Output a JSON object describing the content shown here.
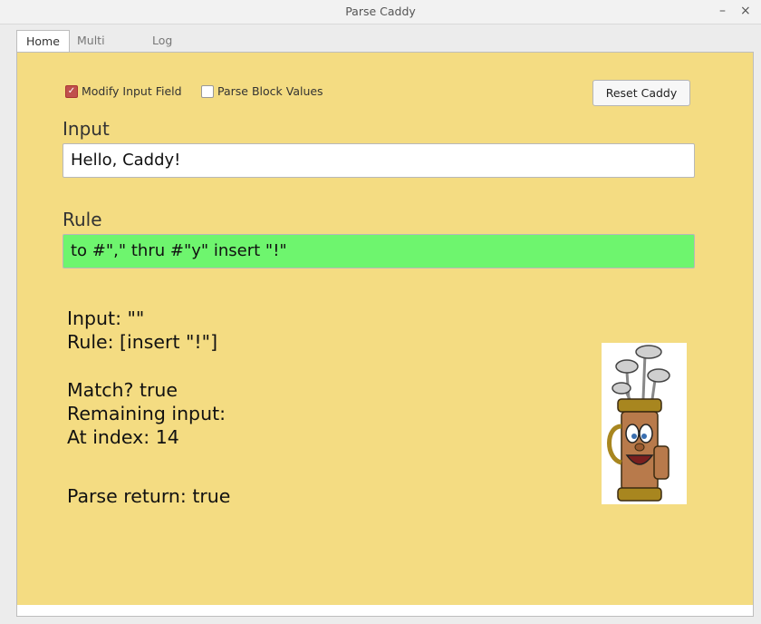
{
  "window": {
    "title": "Parse Caddy",
    "minimize": "–",
    "close": "×"
  },
  "tabs": [
    "Home",
    "Multi Rule",
    "Log"
  ],
  "options": {
    "modify_input": {
      "label": "Modify Input Field",
      "checked": true
    },
    "parse_block": {
      "label": "Parse Block Values",
      "checked": false
    }
  },
  "reset_button": "Reset Caddy",
  "input": {
    "label": "Input",
    "value": "Hello, Caddy!"
  },
  "rule": {
    "label": "Rule",
    "value": "to #\",\" thru #\"y\" insert \"!\""
  },
  "output": {
    "input_line": "Input: \"\"",
    "rule_line": "Rule: [insert \"!\"]",
    "match_line": "Match? true",
    "remaining_line": "Remaining input:",
    "index_line": "At index: 14",
    "return_line": "Parse return: true"
  },
  "colors": {
    "panel": "#f4dc82",
    "rule_ok": "#6ef56e",
    "check_accent": "#c0504d"
  }
}
